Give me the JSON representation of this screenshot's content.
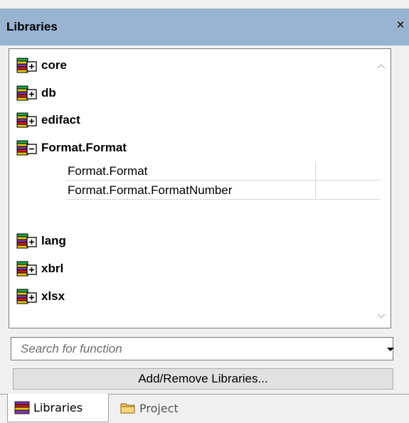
{
  "panel": {
    "title": "Libraries",
    "close_glyph": "×"
  },
  "libraries": [
    {
      "label": "core",
      "state": "collapsed",
      "icon": "library-plus-icon"
    },
    {
      "label": "db",
      "state": "collapsed",
      "icon": "library-plus-icon"
    },
    {
      "label": "edifact",
      "state": "collapsed",
      "icon": "library-plus-icon"
    },
    {
      "label": "Format.Format",
      "state": "expanded",
      "icon": "library-minus-icon"
    },
    {
      "label": "lang",
      "state": "collapsed",
      "icon": "library-plus-icon"
    },
    {
      "label": "xbrl",
      "state": "collapsed",
      "icon": "library-plus-icon"
    },
    {
      "label": "xlsx",
      "state": "collapsed",
      "icon": "library-plus-icon"
    }
  ],
  "functions": [
    {
      "label": "Format.Format"
    },
    {
      "label": "Format.Format.FormatNumber"
    }
  ],
  "search": {
    "placeholder": "Search for function",
    "value": ""
  },
  "add_remove_button": "Add/Remove Libraries...",
  "tabs": [
    {
      "label": "Libraries",
      "active": true,
      "icon": "books-icon"
    },
    {
      "label": "Project",
      "active": false,
      "icon": "folder-icon"
    }
  ],
  "colors": {
    "titlebar": "#99b4d1",
    "panel_bg": "#f0f0f0",
    "tree_bg": "#ffffff",
    "folder": "#f2c25a"
  }
}
